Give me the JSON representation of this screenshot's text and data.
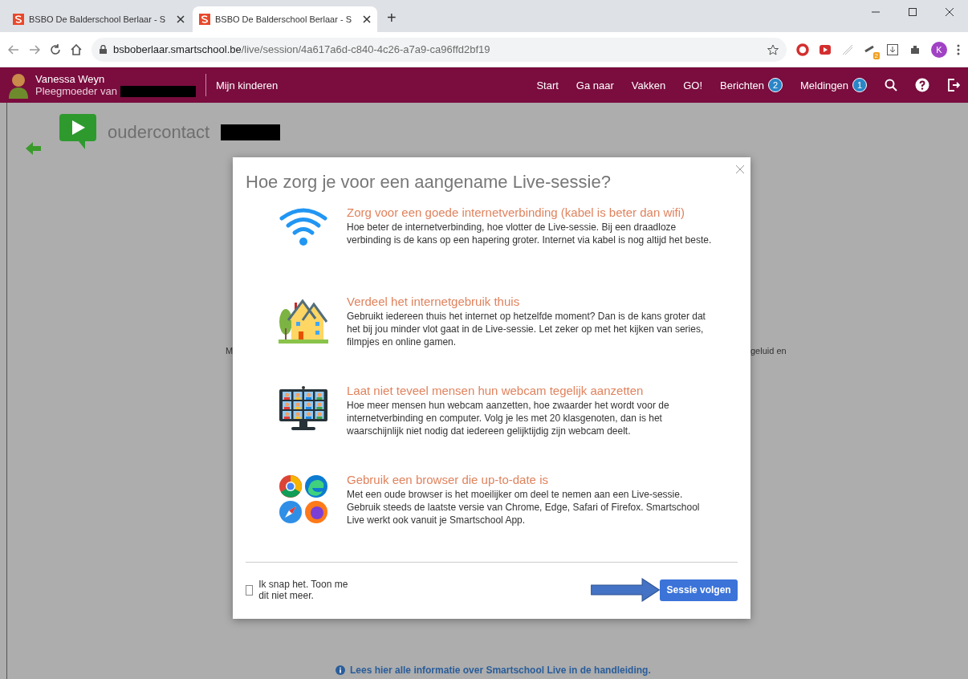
{
  "browser": {
    "tabs": [
      {
        "title": "BSBO De Balderschool Berlaar - S",
        "selected": false
      },
      {
        "title": "BSBO De Balderschool Berlaar - S",
        "selected": true
      }
    ],
    "new_tab": "+",
    "url_host": "bsboberlaar.smartschool.be",
    "url_path": "/live/session/4a617a6d-c840-4c26-a7a9-ca96ffd2bf19",
    "extension_badge": "2",
    "profile_initial": "K"
  },
  "nav": {
    "user_name": "Vanessa Weyn",
    "user_role": "Pleegmoeder van",
    "my_children": "Mijn kinderen",
    "links": [
      {
        "label": "Start"
      },
      {
        "label": "Ga naar"
      },
      {
        "label": "Vakken"
      },
      {
        "label": "GO!"
      },
      {
        "label": "Berichten",
        "count": "2"
      },
      {
        "label": "Meldingen",
        "count": "1"
      }
    ]
  },
  "page": {
    "title": "oudercontact",
    "fragment_left": "M",
    "fragment_right": "geluid en",
    "help_link": "Lees hier alle informatie over Smartschool Live in de handleiding."
  },
  "modal": {
    "title": "Hoe zorg je voor een aangename Live-sessie?",
    "tips": [
      {
        "kind": "wifi",
        "heading": "Zorg voor een goede internetverbinding (kabel is beter dan wifi)",
        "body": "Hoe beter de internetverbinding, hoe vlotter de Live-sessie. Bij een draadloze verbinding is de kans op een hapering groter. Internet via kabel is nog altijd het beste."
      },
      {
        "kind": "house",
        "heading": "Verdeel het internetgebruik thuis",
        "body": "Gebruikt iedereen thuis het internet op hetzelfde moment? Dan is de kans groter dat het bij jou minder vlot gaat in de Live-sessie. Let zeker op met het kijken van series, filmpjes en online gamen."
      },
      {
        "kind": "webcam",
        "heading": "Laat niet teveel mensen hun webcam tegelijk aanzetten",
        "body": "Hoe meer mensen hun webcam aanzetten, hoe zwaarder het wordt voor de internetverbinding en computer. Volg je les met 20 klasgenoten, dan is het waarschijnlijk niet nodig dat iedereen gelijktijdig zijn webcam deelt."
      },
      {
        "kind": "browsers",
        "heading": "Gebruik een browser die up-to-date is",
        "body": "Met een oude browser is het moeilijker om deel te nemen aan een Live-sessie. Gebruik steeds de laatste versie van Chrome, Edge, Safari of Firefox. Smartschool Live werkt ook vanuit je Smartschool App."
      }
    ],
    "checkbox": {
      "label": "Ik snap het. Toon me dit niet meer.",
      "checked": false
    },
    "button": "Sessie volgen"
  }
}
